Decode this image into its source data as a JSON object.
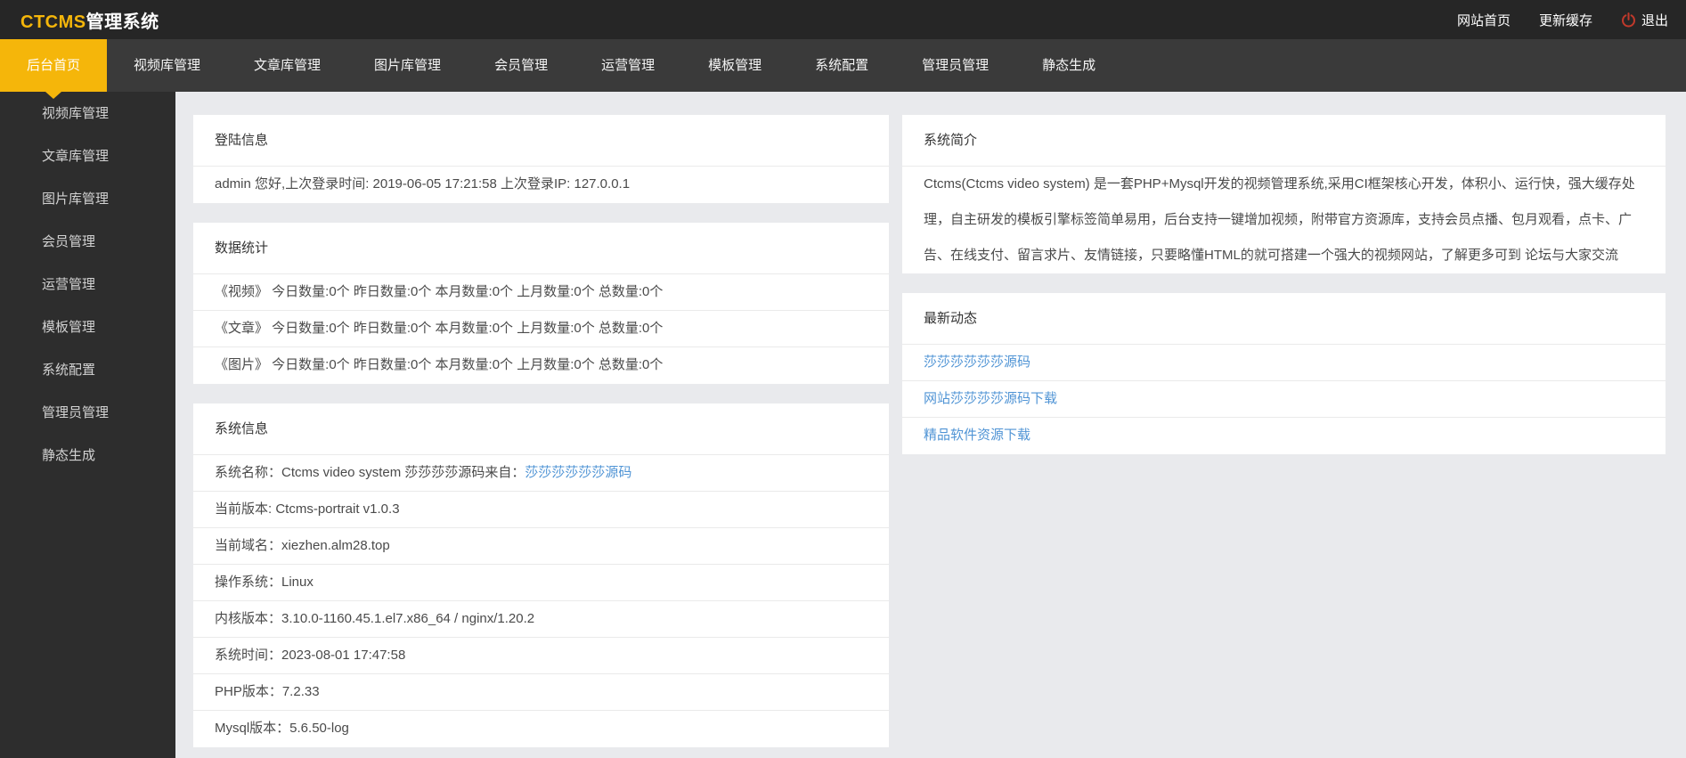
{
  "colors": {
    "accent_yellow": "#f5b60a",
    "link_blue": "#5094d5",
    "logout_red": "#c0392b"
  },
  "header": {
    "brand_primary": "CTCMS",
    "brand_secondary": "管理系统",
    "link_site_home": "网站首页",
    "link_refresh_cache": "更新缓存",
    "link_logout": "退出"
  },
  "nav": {
    "tabs": [
      {
        "label": "后台首页",
        "active": true
      },
      {
        "label": "视频库管理",
        "active": false
      },
      {
        "label": "文章库管理",
        "active": false
      },
      {
        "label": "图片库管理",
        "active": false
      },
      {
        "label": "会员管理",
        "active": false
      },
      {
        "label": "运营管理",
        "active": false
      },
      {
        "label": "模板管理",
        "active": false
      },
      {
        "label": "系统配置",
        "active": false
      },
      {
        "label": "管理员管理",
        "active": false
      },
      {
        "label": "静态生成",
        "active": false
      }
    ]
  },
  "sidebar": {
    "items": [
      {
        "label": "视频库管理"
      },
      {
        "label": "文章库管理"
      },
      {
        "label": "图片库管理"
      },
      {
        "label": "会员管理"
      },
      {
        "label": "运营管理"
      },
      {
        "label": "模板管理"
      },
      {
        "label": "系统配置"
      },
      {
        "label": "管理员管理"
      },
      {
        "label": "静态生成"
      }
    ]
  },
  "panels": {
    "login": {
      "title": "登陆信息",
      "content": "admin 您好,上次登录时间: 2019-06-05 17:21:58 上次登录IP: 127.0.0.1"
    },
    "stats": {
      "title": "数据统计",
      "rows": [
        "《视频》 今日数量:0个 昨日数量:0个 本月数量:0个 上月数量:0个 总数量:0个",
        "《文章》 今日数量:0个 昨日数量:0个 本月数量:0个 上月数量:0个 总数量:0个",
        "《图片》 今日数量:0个 昨日数量:0个 本月数量:0个 上月数量:0个 总数量:0个"
      ]
    },
    "sysinfo": {
      "title": "系统信息",
      "row_name_text": "系统名称：Ctcms video system 莎莎莎莎源码来自：",
      "row_name_link": "莎莎莎莎莎莎源码",
      "rows": [
        "当前版本: Ctcms-portrait v1.0.3",
        "当前域名：xiezhen.alm28.top",
        "操作系统：Linux",
        "内核版本：3.10.0-1160.45.1.el7.x86_64 / nginx/1.20.2",
        "系统时间：2023-08-01 17:47:58",
        "PHP版本：7.2.33",
        "Mysql版本：5.6.50-log"
      ]
    },
    "intro": {
      "title": "系统简介",
      "content": "Ctcms(Ctcms video system) 是一套PHP+Mysql开发的视频管理系统,采用CI框架核心开发，体积小、运行快，强大缓存处理，自主研发的模板引擎标签简单易用，后台支持一键增加视频，附带官方资源库，支持会员点播、包月观看，点卡、广告、在线支付、留言求片、友情链接，只要略懂HTML的就可搭建一个强大的视频网站，了解更多可到 论坛与大家交流"
    },
    "news": {
      "title": "最新动态",
      "links": [
        "莎莎莎莎莎莎源码",
        "网站莎莎莎莎源码下载",
        "精品软件资源下载"
      ]
    }
  }
}
